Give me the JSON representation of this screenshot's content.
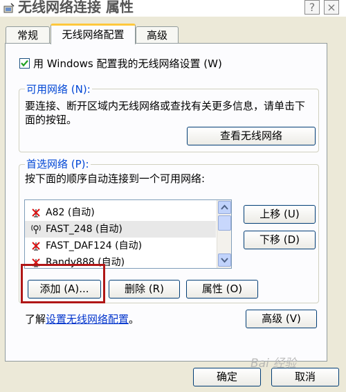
{
  "window": {
    "title": "无线网络连接 属性",
    "help_button": "?",
    "close_button": "×"
  },
  "tabs": [
    {
      "label": "常规",
      "active": false
    },
    {
      "label": "无线网络配置",
      "active": true
    },
    {
      "label": "高级",
      "active": false
    }
  ],
  "use_windows_checkbox": {
    "checked": true,
    "label": "用 Windows 配置我的无线网络设置 (W)"
  },
  "available_networks": {
    "legend": "可用网络 (N):",
    "description": "要连接、断开区域内无线网络或查找有关更多信息，请单击下面的按钮。",
    "view_button": "查看无线网络"
  },
  "preferred_networks": {
    "legend": "首选网络 (P):",
    "description": "按下面的顺序自动连接到一个可用网络:",
    "items": [
      {
        "name": "A82 (自动)",
        "icon": "network-disconnected-icon",
        "selected": false
      },
      {
        "name": "FAST_248 (自动)",
        "icon": "network-antenna-icon",
        "selected": true
      },
      {
        "name": "FAST_DAF124 (自动)",
        "icon": "network-disconnected-icon",
        "selected": false
      },
      {
        "name": "Randy888 (自动)",
        "icon": "network-disconnected-icon",
        "selected": false
      }
    ],
    "move_up_button": "上移 (U)",
    "move_down_button": "下移 (D)",
    "add_button": "添加 (A)...",
    "remove_button": "删除 (R)",
    "properties_button": "属性 (O)"
  },
  "learn_more": {
    "prefix": "了解",
    "link": "设置无线网络配置",
    "suffix": "。"
  },
  "advanced_button": "高级 (V)",
  "ok_button": "确定",
  "cancel_button": "取消",
  "watermark": "Bai 经验",
  "colors": {
    "window_bg": "#ece9d8",
    "panel_bg": "#fcfcfe",
    "legend_blue": "#0046d5",
    "highlight_red": "#b01616",
    "active_tab_accent": "#ffc83c"
  }
}
